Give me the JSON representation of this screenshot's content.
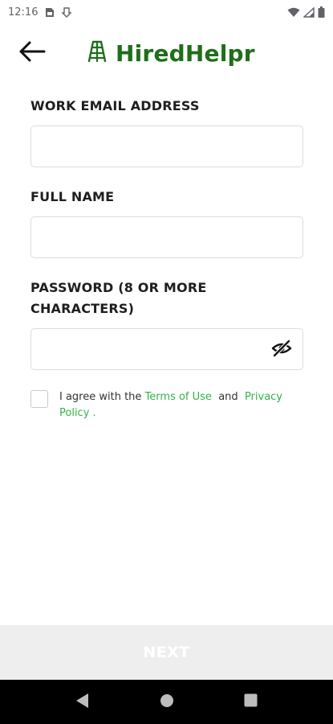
{
  "status_bar": {
    "time": "12:16",
    "icons": [
      "sim-card-icon",
      "download-icon",
      "wifi-icon",
      "signal-icon",
      "battery-icon"
    ]
  },
  "header": {
    "back_icon": "arrow-left-icon",
    "logo_icon": "ladder-icon",
    "brand_name": "HiredHelpr",
    "brand_color": "#1f6e1a"
  },
  "form": {
    "email": {
      "label": "WORK EMAIL ADDRESS",
      "value": "",
      "placeholder": ""
    },
    "full_name": {
      "label": "FULL NAME",
      "value": "",
      "placeholder": ""
    },
    "password": {
      "label_line1": "PASSWORD (8 OR MORE",
      "label_line2": "CHARACTERS)",
      "value": "",
      "placeholder": "",
      "toggle_icon": "eye-off-icon"
    }
  },
  "agreement": {
    "checked": false,
    "prefix": "I agree with the ",
    "terms_link": "Terms of Use",
    "middle": "  and  ",
    "privacy_link": "Privacy Policy",
    "suffix": " .",
    "link_color": "#33b249"
  },
  "next_button": {
    "label": "NEXT"
  },
  "nav_bar": {
    "icons": [
      "nav-back-icon",
      "nav-home-icon",
      "nav-recents-icon"
    ]
  }
}
